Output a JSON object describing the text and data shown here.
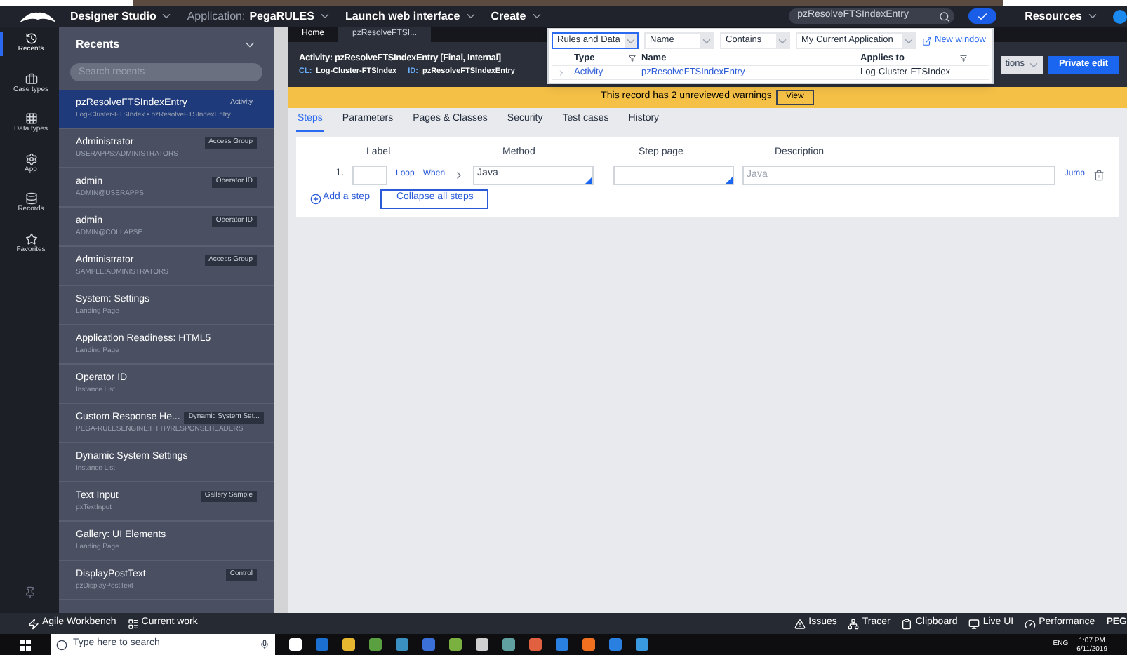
{
  "header": {
    "menus": [
      {
        "label": "Designer Studio"
      },
      {
        "prefix": "Application:",
        "label": "PegaRULES"
      },
      {
        "label": "Launch web interface"
      },
      {
        "label": "Create"
      }
    ],
    "search_value": "pzResolveFTSIndexEntry",
    "resources": "Resources"
  },
  "rail": [
    {
      "kind": "recents",
      "label": "Recents",
      "selected": true
    },
    {
      "kind": "case",
      "label": "Case types",
      "selected": false
    },
    {
      "kind": "data",
      "label": "Data types",
      "selected": false
    },
    {
      "kind": "app",
      "label": "App",
      "selected": false
    },
    {
      "kind": "records",
      "label": "Records",
      "selected": false
    },
    {
      "kind": "favorites",
      "label": "Favorites",
      "selected": false
    }
  ],
  "sidebar": {
    "title": "Recents",
    "search_placeholder": "Search recents",
    "items": [
      {
        "name": "pzResolveFTSIndexEntry",
        "badge": "Activity",
        "subtitle": "Log-Cluster-FTSIndex • pzResolveFTSIndexEntry",
        "selected": true
      },
      {
        "name": "Administrator",
        "badge": "Access Group",
        "subtitle": "USERAPPS:ADMINISTRATORS",
        "selected": false
      },
      {
        "name": "admin",
        "badge": "Operator ID",
        "subtitle": "ADMIN@USERAPPS",
        "selected": false
      },
      {
        "name": "admin",
        "badge": "Operator ID",
        "subtitle": "ADMIN@COLLAPSE",
        "selected": false
      },
      {
        "name": "Administrator",
        "badge": "Access Group",
        "subtitle": "SAMPLE:ADMINISTRATORS",
        "selected": false
      },
      {
        "name": "System: Settings",
        "subtitle": "Landing Page",
        "selected": false
      },
      {
        "name": "Application Readiness: HTML5",
        "subtitle": "Landing Page",
        "selected": false
      },
      {
        "name": "Operator ID",
        "subtitle": "Instance List",
        "selected": false
      },
      {
        "name": "Custom Response He...",
        "badge": "Dynamic System Set...",
        "subtitle": "PEGA-RULESENGINE:HTTP/RESPONSEHEADERS",
        "selected": false
      },
      {
        "name": "Dynamic System Settings",
        "subtitle": "Instance List",
        "selected": false
      },
      {
        "name": "Text Input",
        "badge": "Gallery Sample",
        "subtitle": "pxTextInput",
        "selected": false
      },
      {
        "name": "Gallery: UI Elements",
        "subtitle": "Landing Page",
        "selected": false
      },
      {
        "name": "DisplayPostText",
        "badge": "Control",
        "subtitle": "pzDisplayPostText",
        "selected": false
      }
    ]
  },
  "doc_tabs": [
    {
      "label": "Home",
      "selected": false
    },
    {
      "label": "pzResolveFTSI...",
      "selected": true
    }
  ],
  "record": {
    "title": "Activity: pzResolveFTSIndexEntry [Final, Internal]",
    "class_label": "CL:",
    "class": "Log-Cluster-FTSIndex",
    "id_label": "ID:",
    "id": "pzResolveFTSIndexEntry",
    "actions": "tions",
    "private_edit": "Private edit"
  },
  "warning": {
    "text": "This record has 2 unreviewed warnings",
    "button": "View"
  },
  "rule_tabs": [
    {
      "label": "Steps",
      "selected": true
    },
    {
      "label": "Parameters",
      "selected": false
    },
    {
      "label": "Pages & Classes",
      "selected": false
    },
    {
      "label": "Security",
      "selected": false
    },
    {
      "label": "Test cases",
      "selected": false
    },
    {
      "label": "History",
      "selected": false
    }
  ],
  "steps": {
    "headers": [
      "Label",
      "Method",
      "Step page",
      "Description"
    ],
    "rows": [
      {
        "number": "1.",
        "loop": "Loop",
        "when": "When",
        "method": "Java",
        "description_placeholder": "Java",
        "jump": "Jump"
      }
    ],
    "add_step": "Add a step",
    "collapse": "Collapse all steps"
  },
  "popup": {
    "filters": [
      "Rules and Data",
      "Name",
      "Contains",
      "My Current Application"
    ],
    "new_window": "New window",
    "columns": [
      "Type",
      "Name",
      "Applies to"
    ],
    "rows": [
      {
        "type": "Activity",
        "name": "pzResolveFTSIndexEntry",
        "applies_to": "Log-Cluster-FTSIndex"
      }
    ]
  },
  "workbench": {
    "left": [
      {
        "kind": "agile",
        "label": "Agile Workbench"
      },
      {
        "kind": "work",
        "label": "Current work"
      }
    ],
    "right": [
      {
        "kind": "issues",
        "label": "Issues"
      },
      {
        "kind": "tracer",
        "label": "Tracer"
      },
      {
        "kind": "clipboard",
        "label": "Clipboard"
      },
      {
        "kind": "live",
        "label": "Live UI"
      },
      {
        "kind": "performance",
        "label": "Performance"
      },
      {
        "kind": "none",
        "label": "PEG"
      }
    ]
  },
  "taskbar": {
    "search_placeholder": "Type here to search",
    "language": "ENG",
    "time": "1:07 PM",
    "date": "6/11/2019"
  }
}
